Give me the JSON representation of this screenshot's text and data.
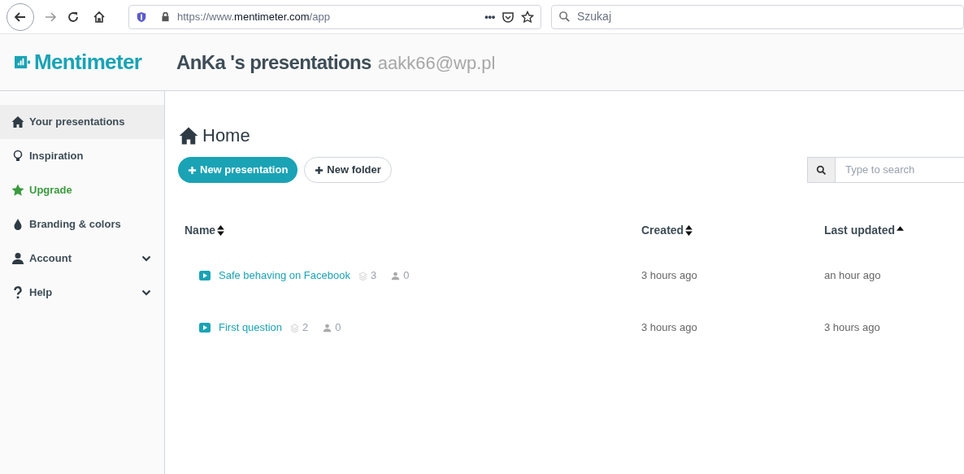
{
  "browser": {
    "url": {
      "prefix": "https://www.",
      "host": "mentimeter.com",
      "path": "/app"
    },
    "more": "•••",
    "search_placeholder": "Szukaj"
  },
  "header": {
    "logo": "Mentimeter",
    "title": "AnKa 's presentations",
    "email": "aakk66@wp.pl"
  },
  "sidebar": {
    "items": [
      {
        "kind": "home",
        "label": "Your presentations",
        "selected": true,
        "expandable": false
      },
      {
        "kind": "bulb",
        "label": "Inspiration",
        "selected": false,
        "expandable": false
      },
      {
        "kind": "star",
        "label": "Upgrade",
        "selected": false,
        "expandable": false
      },
      {
        "kind": "drop",
        "label": "Branding & colors",
        "selected": false,
        "expandable": false
      },
      {
        "kind": "user",
        "label": "Account",
        "selected": false,
        "expandable": true
      },
      {
        "kind": "help",
        "label": "Help",
        "selected": false,
        "expandable": true
      }
    ]
  },
  "main": {
    "heading": "Home",
    "buttons": [
      {
        "kind": "primary",
        "label": "New presentation"
      },
      {
        "kind": "secondary",
        "label": "New folder"
      }
    ],
    "search": {
      "placeholder": "Type to search"
    },
    "table": {
      "columns": [
        {
          "label": "Name",
          "sortable": true,
          "sorted_ascending": false
        },
        {
          "label": "Created",
          "sortable": true,
          "sorted_ascending": false
        },
        {
          "label": "Last updated",
          "sortable": true,
          "sorted_ascending": true
        }
      ],
      "rows": [
        {
          "name": "Safe behaving on Facebook",
          "slides": "3",
          "participants": "0",
          "created": "3 hours ago",
          "updated": "an hour ago"
        },
        {
          "name": "First question",
          "slides": "2",
          "participants": "0",
          "created": "3 hours ago",
          "updated": "3 hours ago"
        }
      ]
    }
  }
}
